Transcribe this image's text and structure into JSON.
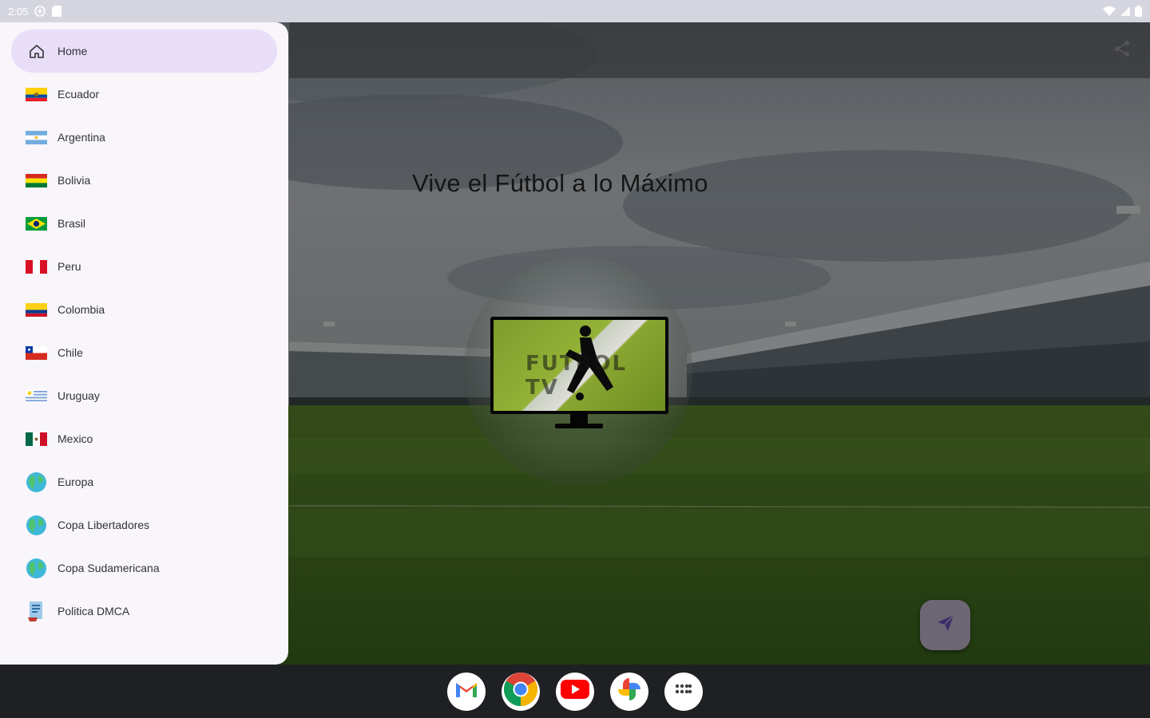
{
  "status_bar": {
    "time": "2:05"
  },
  "drawer": {
    "items": [
      {
        "label": "Home",
        "icon": "home-icon",
        "active": true
      },
      {
        "label": "Ecuador",
        "icon": "ecuador-flag-icon"
      },
      {
        "label": "Argentina",
        "icon": "argentina-flag-icon"
      },
      {
        "label": "Bolivia",
        "icon": "bolivia-flag-icon"
      },
      {
        "label": "Brasil",
        "icon": "brasil-flag-icon"
      },
      {
        "label": "Peru",
        "icon": "peru-flag-icon"
      },
      {
        "label": "Colombia",
        "icon": "colombia-flag-icon"
      },
      {
        "label": "Chile",
        "icon": "chile-flag-icon"
      },
      {
        "label": "Uruguay",
        "icon": "uruguay-flag-icon"
      },
      {
        "label": "Mexico",
        "icon": "mexico-flag-icon"
      },
      {
        "label": "Europa",
        "icon": "globe-icon"
      },
      {
        "label": "Copa Libertadores",
        "icon": "globe-icon"
      },
      {
        "label": "Copa Sudamericana",
        "icon": "globe-icon"
      },
      {
        "label": "Politica DMCA",
        "icon": "document-icon"
      }
    ]
  },
  "hero": {
    "tagline": "Vive el Fútbol a lo Máximo",
    "logo_text": "FUTBOL TV"
  },
  "taskbar": {
    "apps": [
      "gmail-icon",
      "chrome-icon",
      "youtube-icon",
      "photos-icon",
      "app-drawer-icon"
    ]
  },
  "colors": {
    "drawer_bg": "#f8f5fb",
    "active_item_bg": "#e8def8",
    "fab_bg": "#6d6775",
    "taskbar_bg": "#1f2023"
  }
}
